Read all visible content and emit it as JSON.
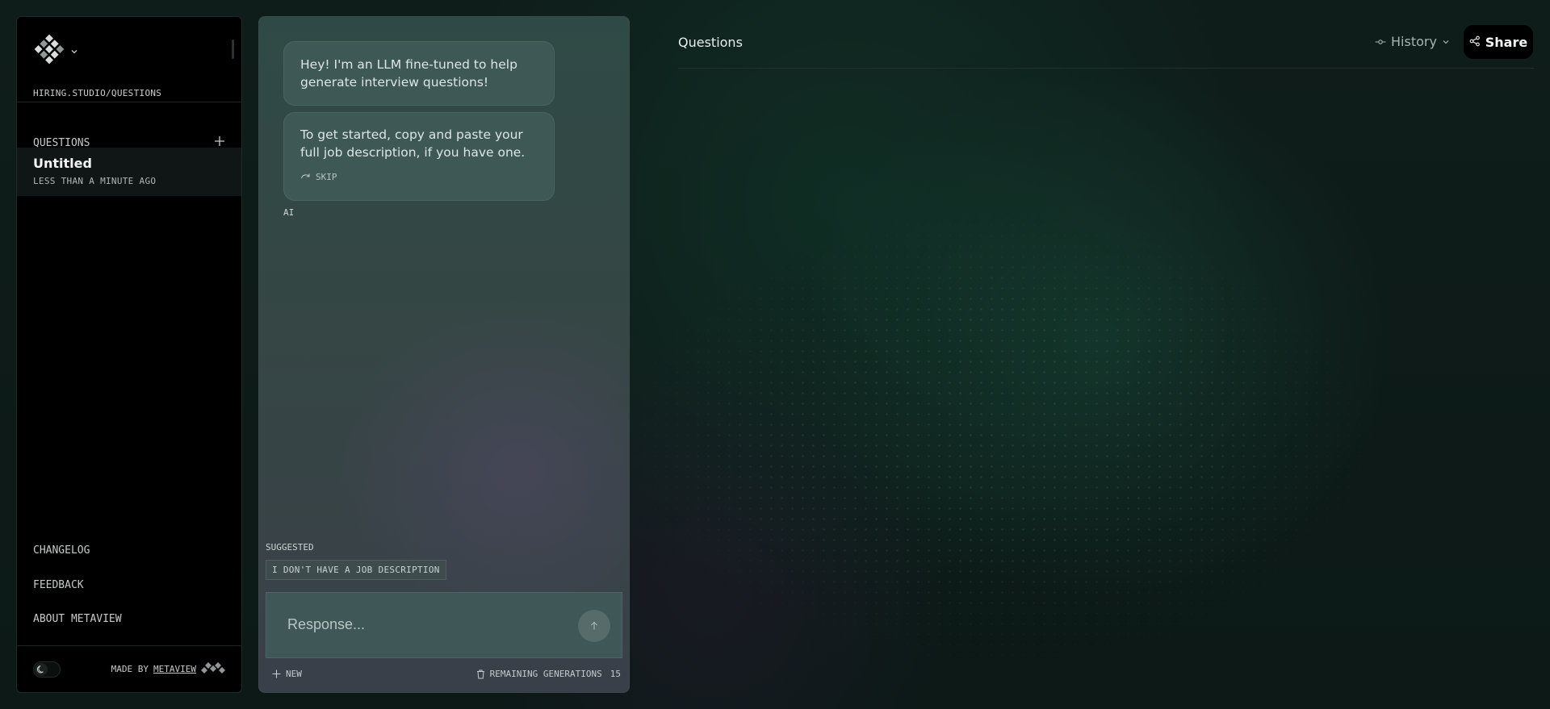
{
  "sidebar": {
    "path": "HIRING.STUDIO/QUESTIONS",
    "questions_label": "QUESTIONS",
    "items": [
      {
        "title": "Untitled",
        "subtitle": "LESS THAN A MINUTE AGO"
      }
    ],
    "links": [
      "CHANGELOG",
      "FEEDBACK",
      "ABOUT METAVIEW"
    ],
    "made_by_prefix": "MADE BY",
    "made_by_link": "METAVIEW"
  },
  "chat": {
    "messages": [
      {
        "text": "Hey! I'm an LLM fine-tuned to help generate interview questions!"
      },
      {
        "text": "To get started, copy and paste your full job description, if you have one.",
        "action": "SKIP"
      }
    ],
    "sender_label": "AI",
    "suggested_label": "SUGGESTED",
    "suggestion": "I DON'T HAVE A JOB DESCRIPTION",
    "input_placeholder": "Response...",
    "new_label": "NEW",
    "remaining_label": "REMAINING GENERATIONS",
    "remaining_count": "15"
  },
  "main": {
    "title": "Questions",
    "history_label": "History",
    "share_label": "Share"
  },
  "icons": {
    "logo": "diamond-grid-logo-icon",
    "theme": "moon-icon",
    "skip": "redo-arrow-icon",
    "send": "arrow-up-icon",
    "history": "commit-icon",
    "share": "share-icon",
    "remaining": "trash-icon"
  }
}
